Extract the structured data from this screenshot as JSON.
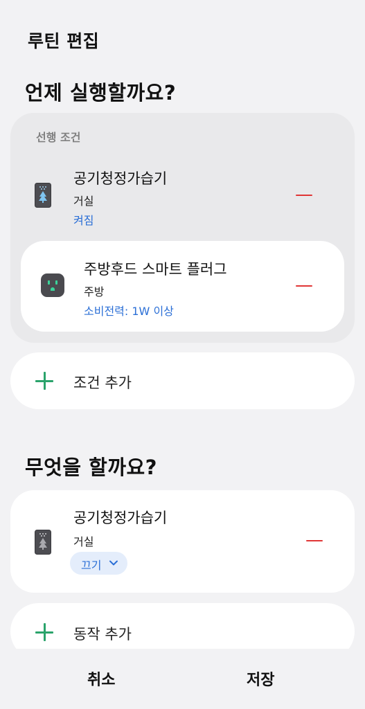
{
  "header": {
    "title": "루틴 편집"
  },
  "when": {
    "title": "언제 실행할까요?",
    "precondition": {
      "label": "선행 조건",
      "device": {
        "icon": "air-purifier-humidifier-icon",
        "name": "공기청정가습기",
        "room": "거실",
        "state": "켜짐"
      }
    },
    "condition": {
      "icon": "smart-plug-icon",
      "name": "주방후드 스마트 플러그",
      "room": "주방",
      "state": "소비전력: 1W 이상"
    },
    "add_label": "조건 추가"
  },
  "what": {
    "title": "무엇을 할까요?",
    "action": {
      "icon": "air-purifier-humidifier-icon",
      "name": "공기청정가습기",
      "room": "거실",
      "selected_option": "끄기"
    },
    "add_label": "동작 추가"
  },
  "footer": {
    "cancel_label": "취소",
    "save_label": "저장"
  },
  "colors": {
    "accent_blue": "#2b6fd6",
    "remove_red": "#e03535",
    "add_green": "#2aa36b",
    "background": "#f2f2f4"
  }
}
